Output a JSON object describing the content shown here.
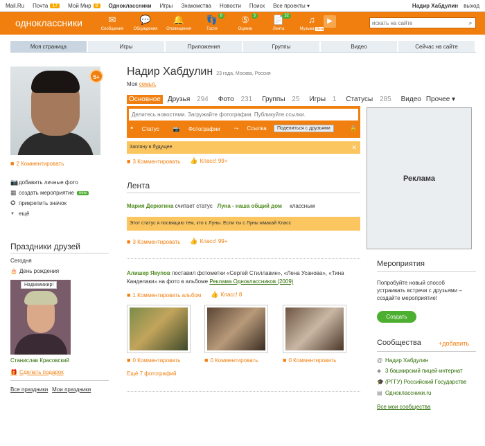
{
  "topbar": {
    "items": [
      {
        "label": "Mail.Ru"
      },
      {
        "label": "Почта",
        "badge": "17"
      },
      {
        "label": "Мой Мир",
        "badge": "8"
      },
      {
        "label": "Одноклассники"
      },
      {
        "label": "Игры"
      },
      {
        "label": "Знакомства"
      },
      {
        "label": "Новости"
      },
      {
        "label": "Поиск"
      },
      {
        "label": "Все проекты ▾"
      }
    ],
    "user": "Надир Хабдулин",
    "exit": "выход"
  },
  "header": {
    "logo": "одноклассники",
    "icons": [
      {
        "label": "Сообщения",
        "icon": "envelope-icon",
        "glyph": "✉"
      },
      {
        "label": "Обсуждения",
        "icon": "chat-icon",
        "glyph": "💬"
      },
      {
        "label": "Оповещения",
        "icon": "bell-icon",
        "glyph": "🔔"
      },
      {
        "label": "Гости",
        "icon": "footprints-icon",
        "glyph": "👣",
        "badge": "8"
      },
      {
        "label": "Оценки",
        "icon": "rating-icon",
        "glyph": "⑤",
        "badge": "3"
      },
      {
        "label": "Лента",
        "icon": "feed-icon",
        "glyph": "📄",
        "badge": "32"
      },
      {
        "label": "Музыка",
        "icon": "music-icon",
        "glyph": "♫"
      }
    ],
    "music_new": "New",
    "search_placeholder": "искать на сайте"
  },
  "nav": {
    "tabs": [
      "Моя страница",
      "Игры",
      "Приложения",
      "Группы",
      "Видео",
      "Сейчас на сайте"
    ]
  },
  "profile": {
    "name": "Надир Хабдулин",
    "meta": "23 года, Москва, Россия",
    "family_prefix": "Моя ",
    "family_link": "семья.",
    "level": "5+",
    "comments": "2 Комментировать"
  },
  "left_actions": [
    {
      "label": "добавить личные фото",
      "icon": "camera-icon",
      "glyph": "📷"
    },
    {
      "label": "создать мероприятие",
      "icon": "calendar-icon",
      "glyph": "▦",
      "badge": "new"
    },
    {
      "label": "прикрепить значок",
      "icon": "star-icon",
      "glyph": "✪"
    },
    {
      "label": "ещё",
      "icon": "triangle-down-icon",
      "glyph": "▼"
    }
  ],
  "holidays": {
    "title": "Праздники друзей",
    "today": "Сегодня",
    "birthday": "День рождения",
    "bubble": "Надиииииир!",
    "friend": "Станислав Красовский",
    "gift": "Сделать подарок",
    "all": "Все праздники",
    "mine": "Мои праздники"
  },
  "tabs": [
    {
      "label": "Основное"
    },
    {
      "label": "Друзья",
      "count": "294"
    },
    {
      "label": "Фото",
      "count": "231"
    },
    {
      "label": "Группы",
      "count": "25"
    },
    {
      "label": "Игры",
      "count": "1"
    },
    {
      "label": "Статусы",
      "count": "285"
    },
    {
      "label": "Видео"
    },
    {
      "label": "Прочее ▾"
    }
  ],
  "post": {
    "placeholder": "Делитесь новостями. Загружайте фотографии. Публикуйте ссылки.",
    "status": "Статус",
    "photos": "Фотографии",
    "link": "Ссылка",
    "share": "Поделиться с друзьями"
  },
  "status_box": {
    "text": "Загляну в будущее",
    "comment": "3 Комментировать",
    "klass": "Класс! 99+"
  },
  "feed": {
    "title": "Лента",
    "item1": {
      "author": "Мария Дерюгина",
      "action": "считает статус",
      "status": "Луна - наша общий дом",
      "group": "классным",
      "text": "Этот статус я посвящаю тем, кто с Луны. Если ты с Луны жмакай Класс",
      "comment": "3 Комментировать",
      "klass": "Класс! 99+"
    },
    "item2": {
      "author": "Алишер Якупов",
      "line1": "поставил фотометки «Сергей Стиллавин», «Лена Усанова», «Тина",
      "line2": "Канделаки» на фото в альбоме",
      "album": "Реклама Одноклассников (2009)",
      "comment": "1 Комментировать альбом",
      "klass": "Класс! 8",
      "photo_comments": [
        "0 Комментировать",
        "0 Комментировать",
        "0 Комментировать"
      ],
      "more": "Ещё 7 фотографий"
    }
  },
  "ad": {
    "label": "Реклама"
  },
  "events": {
    "title": "Мероприятия",
    "text1": "Попробуйте новый способ",
    "text2": "устраивать встречи с друзьями –",
    "text3": "создайте мероприятие!",
    "button": "Создать"
  },
  "communities": {
    "title": "Сообщества",
    "add": "+добавить",
    "items": [
      "Надир Хабдулин",
      "3 башкирский пицей-интернат",
      "(РГГУ) Российский Государстве",
      "Одноклассники.ru"
    ],
    "all": "Все мои сообщества"
  }
}
